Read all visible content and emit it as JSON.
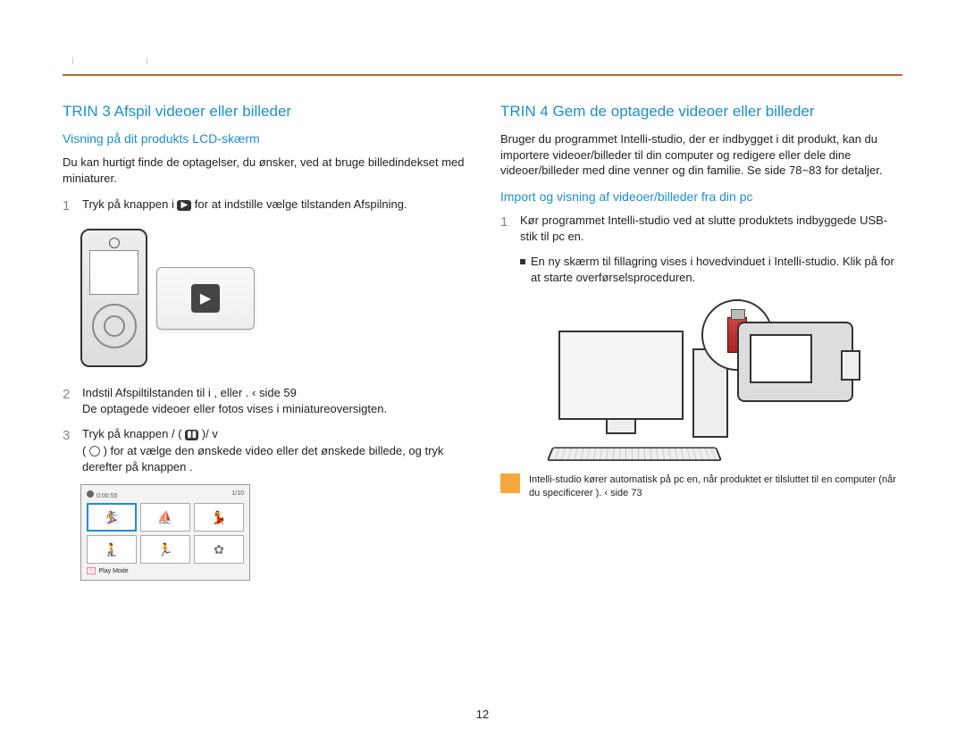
{
  "header": {
    "tab1": "i",
    "tab2": "i"
  },
  "left": {
    "step_title": "TRIN 3  Afspil videoer eller billeder",
    "sub_title": "Visning på dit produkts LCD-skærm",
    "intro": "Du kan hurtigt finde de optagelser, du ønsker, ved at bruge billedindekset med miniaturer.",
    "item1_a": "Tryk på knappen ",
    "item1_b": " i ",
    "item1_c": " for at indstille vælge tilstanden Afspilning.",
    "item2": "Indstil Afspiltilstanden til   i   , eller   .   ‹ side 59",
    "item2_line2": "De optagede videoer eller fotos vises i miniatureoversigten.",
    "item3_a": "Tryk på knappen ",
    "item3_b": " / ",
    "item3_c": " ( ",
    "item3_d": " )/ ",
    "item3_e": " v",
    "item3_line2_a": "( ",
    "item3_line2_b": " ) for at vælge den ønskede video eller det ønskede billede, og tryk derefter på knappen   .",
    "thumbs": {
      "time": "0:00:55",
      "count": "1/10",
      "footer_tag": "=",
      "footer_label": "Play Mode"
    }
  },
  "right": {
    "step_title": "TRIN 4  Gem de optagede videoer eller billeder",
    "intro": "Bruger du programmet Intelli-studio, der er indbygget i dit produkt, kan du importere videoer/billeder til din computer og redigere eller dele dine videoer/billeder med dine venner og din familie. Se side 78~83 for detaljer.",
    "sub_title": "Import og visning af videoer/billeder fra din pc",
    "item1": "Kør programmet Intelli-studio ved at slutte produktets indbyggede USB-stik til pc en.",
    "item1_sub": "En ny skærm til fillagring vises i hovedvinduet i Intelli-studio. Klik på        for at starte overførselsproceduren.",
    "note": "Intelli-studio kører automatisk på pc en, når produktet er tilsluttet til en computer (når du specificerer                                    ).     ‹ side 73"
  },
  "page_number": "12"
}
